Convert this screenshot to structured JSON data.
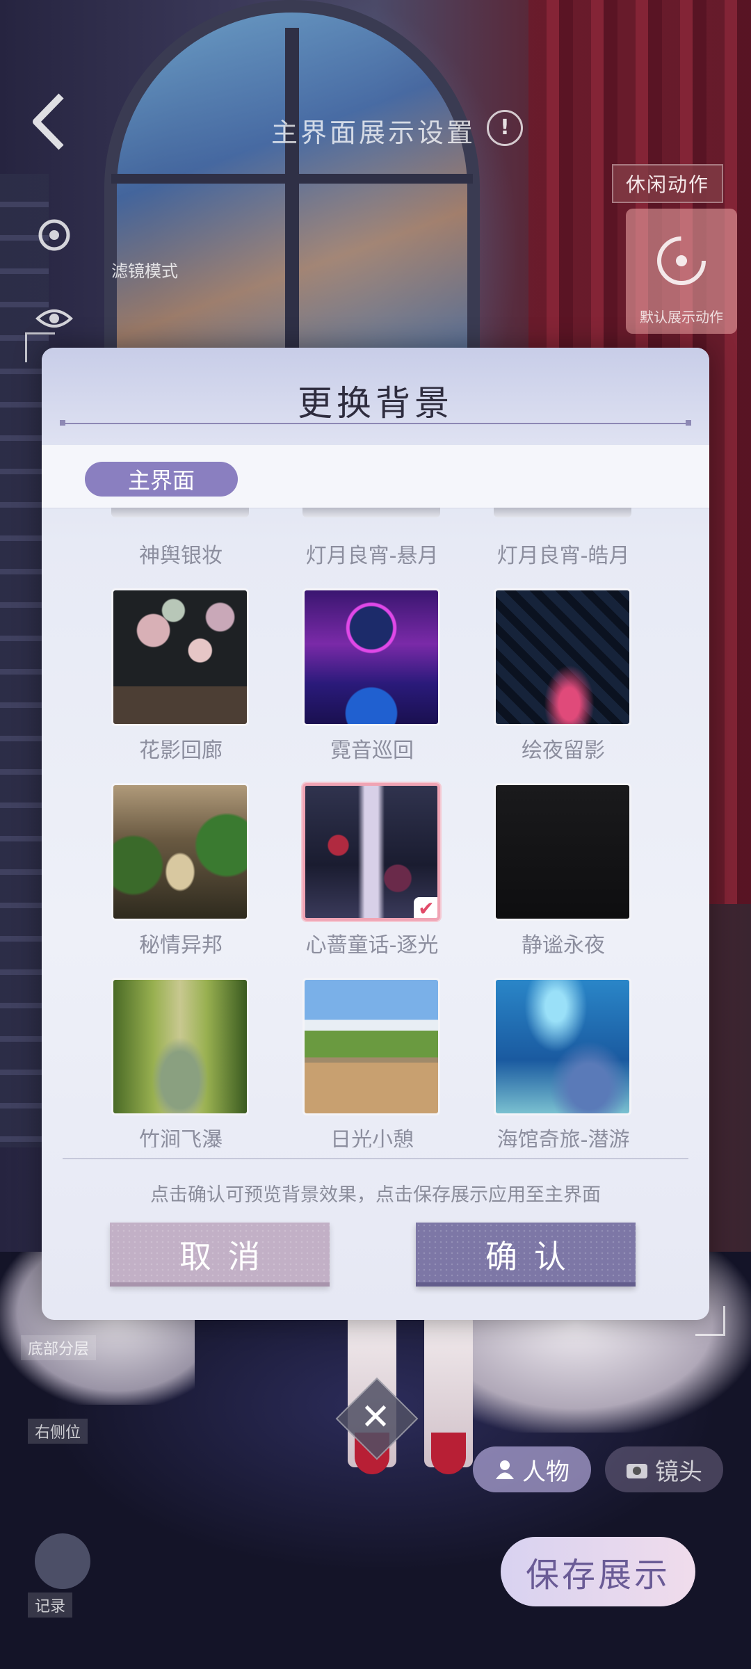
{
  "background": {
    "title": "主界面展示设置",
    "info_symbol": "!",
    "side_labels": {
      "view_mode": "滤镜模式"
    },
    "idle_action_label": "休闲动作",
    "idle_card_label": "默认展示动作",
    "bottom": {
      "character_label": "人物",
      "camera_label": "镜头",
      "save_show_label": "保存展示",
      "left_label_1": "底部分层",
      "left_label_2": "右侧位",
      "left_label_3": "记录"
    },
    "close_symbol": "✕"
  },
  "dialog": {
    "title": "更换背景",
    "tabs": [
      {
        "label": "主界面",
        "active": true
      }
    ],
    "items": [
      {
        "label": "神舆银妆",
        "theme": "t0",
        "partial": true
      },
      {
        "label": "灯月良宵-悬月",
        "theme": "t0",
        "partial": true
      },
      {
        "label": "灯月良宵-皓月",
        "theme": "t0",
        "partial": true
      },
      {
        "label": "花影回廊",
        "theme": "t1"
      },
      {
        "label": "霓音巡回",
        "theme": "t2"
      },
      {
        "label": "绘夜留影",
        "theme": "t3"
      },
      {
        "label": "秘情异邦",
        "theme": "t4"
      },
      {
        "label": "心蔷童话-逐光",
        "theme": "t5",
        "selected": true
      },
      {
        "label": "静谧永夜",
        "theme": "t6"
      },
      {
        "label": "竹涧飞瀑",
        "theme": "t7"
      },
      {
        "label": "日光小憩",
        "theme": "t8"
      },
      {
        "label": "海馆奇旅-潜游",
        "theme": "t9"
      }
    ],
    "selected_check": "✔",
    "tip": "点击确认可预览背景效果，点击保存展示应用至主界面",
    "cancel_label": "取消",
    "confirm_label": "确认"
  },
  "colors": {
    "accent": "#8a7fc0",
    "selected_border": "#f0a4b4",
    "cancel": "#c2b0c6",
    "confirm": "#7d77a6"
  }
}
